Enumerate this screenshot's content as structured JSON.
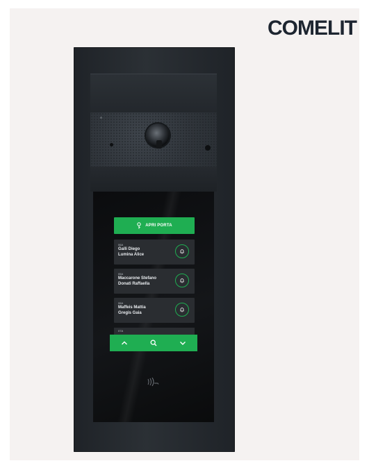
{
  "brand": {
    "logo_text": "COMELIT",
    "accent": "#1fae6b"
  },
  "device": {
    "screen": {
      "open_door_label": "APRI PORTA",
      "entries": [
        {
          "code": "06A",
          "line1": "Galli Diego",
          "line2": "Lumina Alice"
        },
        {
          "code": "05A",
          "line1": "Maccarone Stefano",
          "line2": "Donati Raffaella"
        },
        {
          "code": "06A",
          "line1": "Maffeis Mattia",
          "line2": "Gregis Gaia"
        }
      ],
      "partial_entry_code": "07A",
      "nav": {
        "up": "chevron-up-icon",
        "search": "search-icon",
        "down": "chevron-down-icon"
      },
      "green": "#1fae52"
    }
  }
}
